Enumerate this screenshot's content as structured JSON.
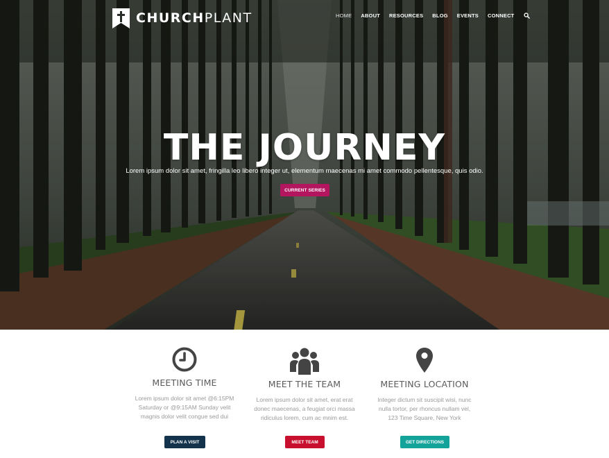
{
  "site": {
    "logo_bold": "CHURCH",
    "logo_light": "PLANT"
  },
  "nav": {
    "items": [
      {
        "label": "HOME",
        "active": true
      },
      {
        "label": "ABOUT"
      },
      {
        "label": "RESOURCES"
      },
      {
        "label": "BLOG"
      },
      {
        "label": "EVENTS"
      },
      {
        "label": "CONNECT"
      }
    ],
    "search_icon": "search-icon"
  },
  "hero": {
    "title": "THE JOURNEY",
    "subtitle": "Lorem ipsum dolor sit amet, fringilla leo libero integer ut, elementum maecenas mi amet commodo pellentesque, quis odio.",
    "button_label": "CURRENT SERIES",
    "button_color": "#b3155f"
  },
  "features": [
    {
      "icon": "clock-icon",
      "title": "MEETING TIME",
      "lines": [
        "Lorem ipsum dolor sit amet @6:15PM",
        "Saturday or @9:15AM Sunday velit",
        "magnis dolor velit congue sed dui"
      ],
      "button_label": "PLAN A VISIT",
      "button_color": "#13334c"
    },
    {
      "icon": "team-icon",
      "title": "MEET THE TEAM",
      "lines": [
        "Lorem ipsum dolor sit amet, erat erat",
        "donec maecenas, a feugiat orci massa",
        "ridiculus lorem, cum ac mnim est."
      ],
      "button_label": "MEET TEAM",
      "button_color": "#c8102e"
    },
    {
      "icon": "map-pin-icon",
      "title": "MEETING LOCATION",
      "lines": [
        "Integer dictum sit suscipit wisi, nunc",
        "nulla tortor, per rhoncus nullam vel,",
        "123 Time Square, New York"
      ],
      "button_label": "GET DIRECTIONS",
      "button_color": "#13a39a"
    }
  ]
}
